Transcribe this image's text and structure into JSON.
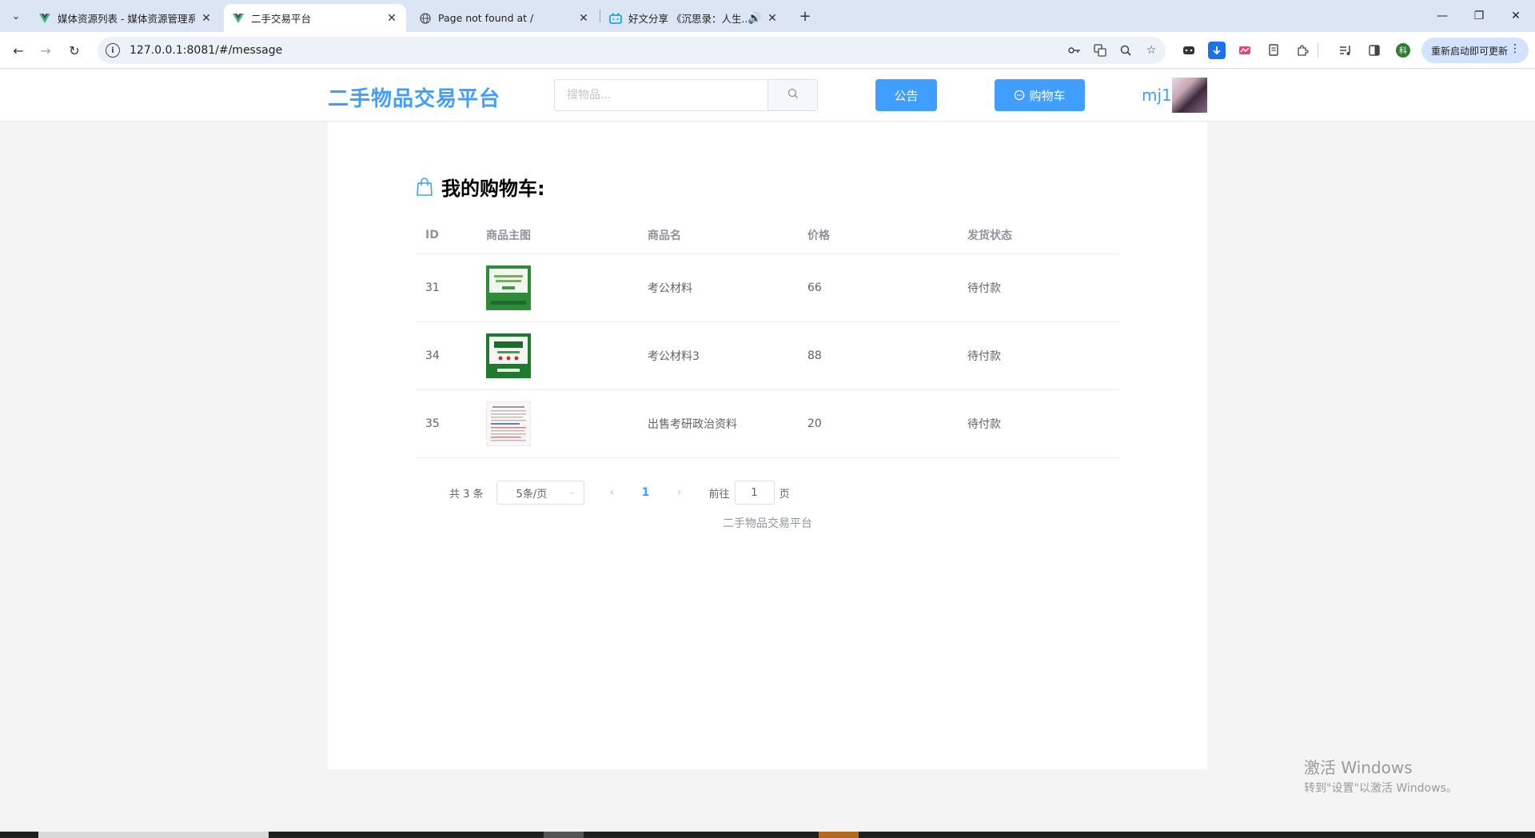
{
  "browser": {
    "tabs": [
      {
        "title": "媒体资源列表 - 媒体资源管理系",
        "favicon": "vue-icon"
      },
      {
        "title": "二手交易平台",
        "favicon": "vue-icon"
      },
      {
        "title": "Page not found at /",
        "favicon": "globe-icon"
      },
      {
        "title": "好文分享 《沉思录：人生...",
        "favicon": "bilibili-icon"
      }
    ],
    "url": "127.0.0.1:8081/#/message",
    "update_label": "重新启动即可更新"
  },
  "header": {
    "logo": "二手物品交易平台",
    "search_placeholder": "搜物品...",
    "notice_label": "公告",
    "cart_label": "购物车",
    "username": "mj1"
  },
  "cart": {
    "title": "我的购物车:",
    "columns": [
      "ID",
      "商品主图",
      "商品名",
      "价格",
      "发货状态"
    ],
    "rows": [
      {
        "id": "31",
        "name": "考公材料",
        "price": "66",
        "status": "待付款"
      },
      {
        "id": "34",
        "name": "考公材料3",
        "price": "88",
        "status": "待付款"
      },
      {
        "id": "35",
        "name": "出售考研政治资料",
        "price": "20",
        "status": "待付款"
      }
    ]
  },
  "pagination": {
    "total": "共 3 条",
    "page_size": "5条/页",
    "current_page": "1",
    "goto_label": "前往",
    "goto_value": "1",
    "goto_suffix": "页"
  },
  "footer": {
    "text": "二手物品交易平台"
  },
  "watermark": {
    "line1": "激活 Windows",
    "line2": "转到\"设置\"以激活 Windows。"
  },
  "colors": {
    "primary": "#409eff",
    "text": "#606266",
    "muted": "#909399"
  }
}
